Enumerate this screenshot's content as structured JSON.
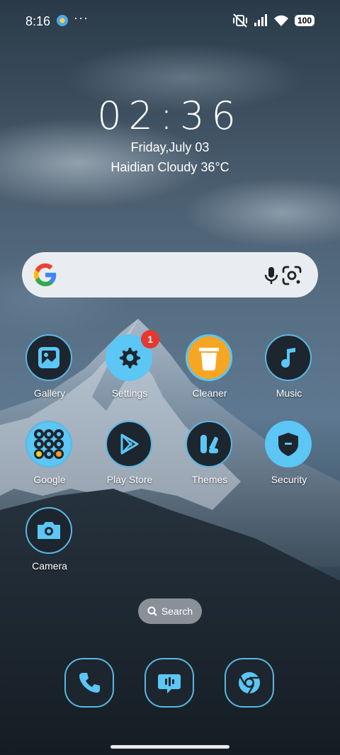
{
  "status_bar": {
    "time": "8:16",
    "dots": "···",
    "battery": "100"
  },
  "clock": {
    "time": "02:36",
    "date": "Friday,July 03",
    "weather": "Haidian Cloudy 36°C"
  },
  "apps": [
    {
      "label": "Gallery",
      "icon": "gallery-icon"
    },
    {
      "label": "Settings",
      "icon": "gear-icon",
      "badge": "1"
    },
    {
      "label": "Cleaner",
      "icon": "trash-icon"
    },
    {
      "label": "Music",
      "icon": "music-note-icon"
    },
    {
      "label": "Google",
      "icon": "folder-icon"
    },
    {
      "label": "Play Store",
      "icon": "play-store-icon"
    },
    {
      "label": "Themes",
      "icon": "themes-icon"
    },
    {
      "label": "Security",
      "icon": "shield-icon"
    },
    {
      "label": "Camera",
      "icon": "camera-icon"
    }
  ],
  "search_pill": {
    "label": "Search"
  },
  "dock": [
    {
      "icon": "phone-icon"
    },
    {
      "icon": "messages-icon"
    },
    {
      "icon": "chrome-icon"
    }
  ],
  "colors": {
    "accent": "#5cc6f5",
    "badge": "#e8372f",
    "cleaner": "#f7a623"
  }
}
